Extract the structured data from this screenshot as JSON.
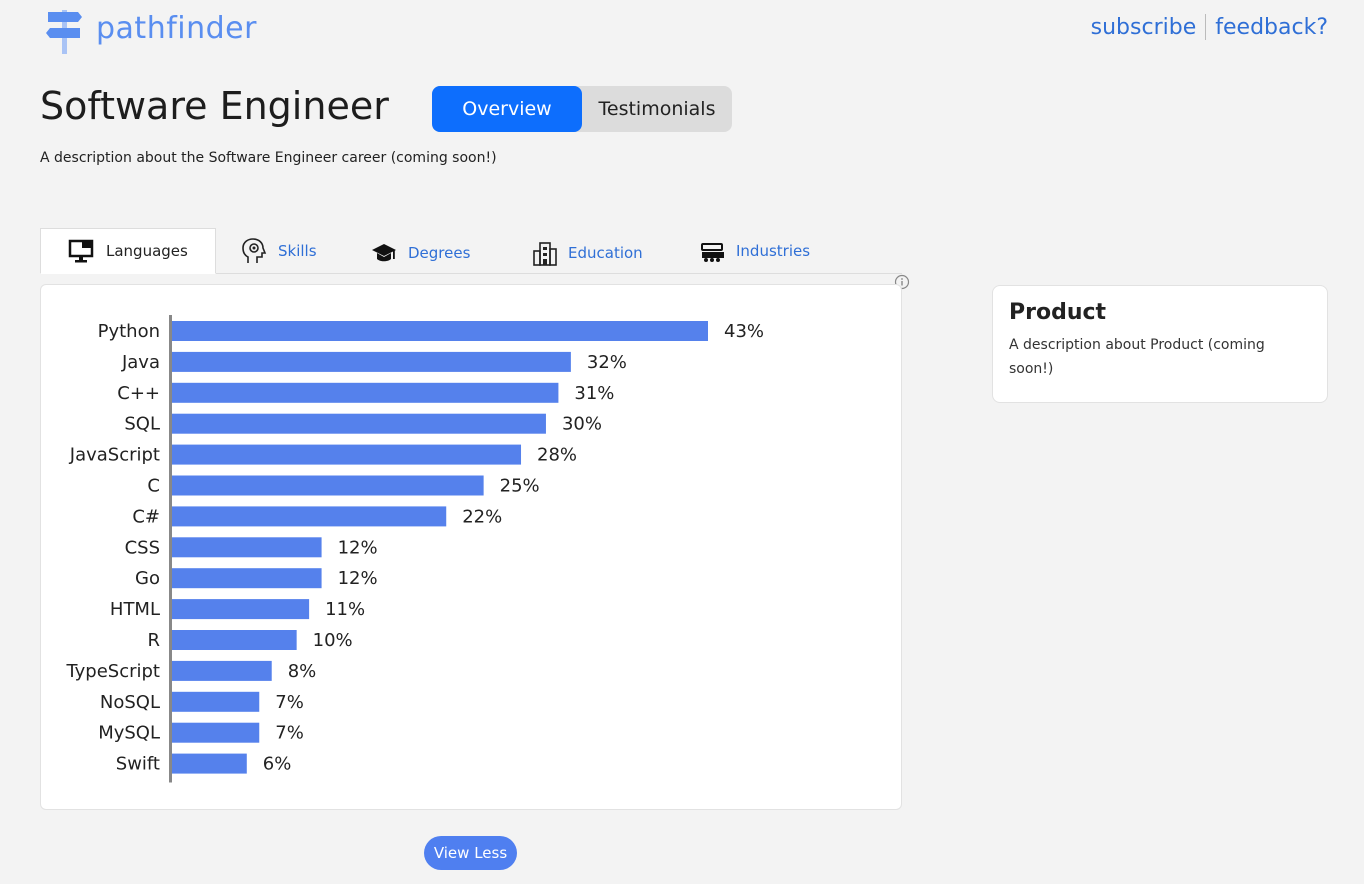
{
  "brand": {
    "name": "pathfinder",
    "color": "#5a8ef0"
  },
  "topnav": {
    "subscribe": "subscribe",
    "feedback": "feedback?"
  },
  "title": "Software Engineer",
  "segments": {
    "overview": "Overview",
    "testimonials": "Testimonials",
    "active": "Overview"
  },
  "description": "A description about the Software Engineer career (coming soon!)",
  "tabs": [
    {
      "label": "Languages",
      "icon": "monitor-icon",
      "active": true
    },
    {
      "label": "Skills",
      "icon": "head-gear-icon",
      "active": false
    },
    {
      "label": "Degrees",
      "icon": "graduation-cap-icon",
      "active": false
    },
    {
      "label": "Education",
      "icon": "building-icon",
      "active": false
    },
    {
      "label": "Industries",
      "icon": "factory-icon",
      "active": false
    }
  ],
  "chart_data": {
    "type": "bar",
    "orientation": "horizontal",
    "categories": [
      "Python",
      "Java",
      "C++",
      "SQL",
      "JavaScript",
      "C",
      "C#",
      "CSS",
      "Go",
      "HTML",
      "R",
      "TypeScript",
      "NoSQL",
      "MySQL",
      "Swift"
    ],
    "values": [
      43,
      32,
      31,
      30,
      28,
      25,
      22,
      12,
      12,
      11,
      10,
      8,
      7,
      7,
      6
    ],
    "data_labels": [
      "43%",
      "32%",
      "31%",
      "30%",
      "28%",
      "25%",
      "22%",
      "12%",
      "12%",
      "11%",
      "10%",
      "8%",
      "7%",
      "7%",
      "6%"
    ],
    "color": "#5581ec",
    "xlim": [
      0,
      43
    ]
  },
  "side_card": {
    "title": "Product",
    "text": "A description about Product (coming soon!)"
  },
  "view_less": "View Less",
  "colors": {
    "accent": "#0d6efd",
    "link": "#2f6fd6",
    "bar": "#5581ec"
  }
}
